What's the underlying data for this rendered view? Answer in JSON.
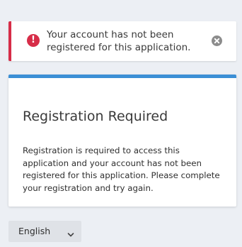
{
  "alert": {
    "message": "Your account has not been registered for this application.",
    "icon": "exclamation-circle-icon",
    "close_icon": "close-circle-icon",
    "accent_color": "#d72d48"
  },
  "card": {
    "title": "Registration Required",
    "body": "Registration is required to access this application and your account has not been registered for this application. Please complete your registration and try again.",
    "accent_color": "#3b8fd5"
  },
  "language": {
    "selected": "English",
    "icon": "chevron-down-icon"
  }
}
